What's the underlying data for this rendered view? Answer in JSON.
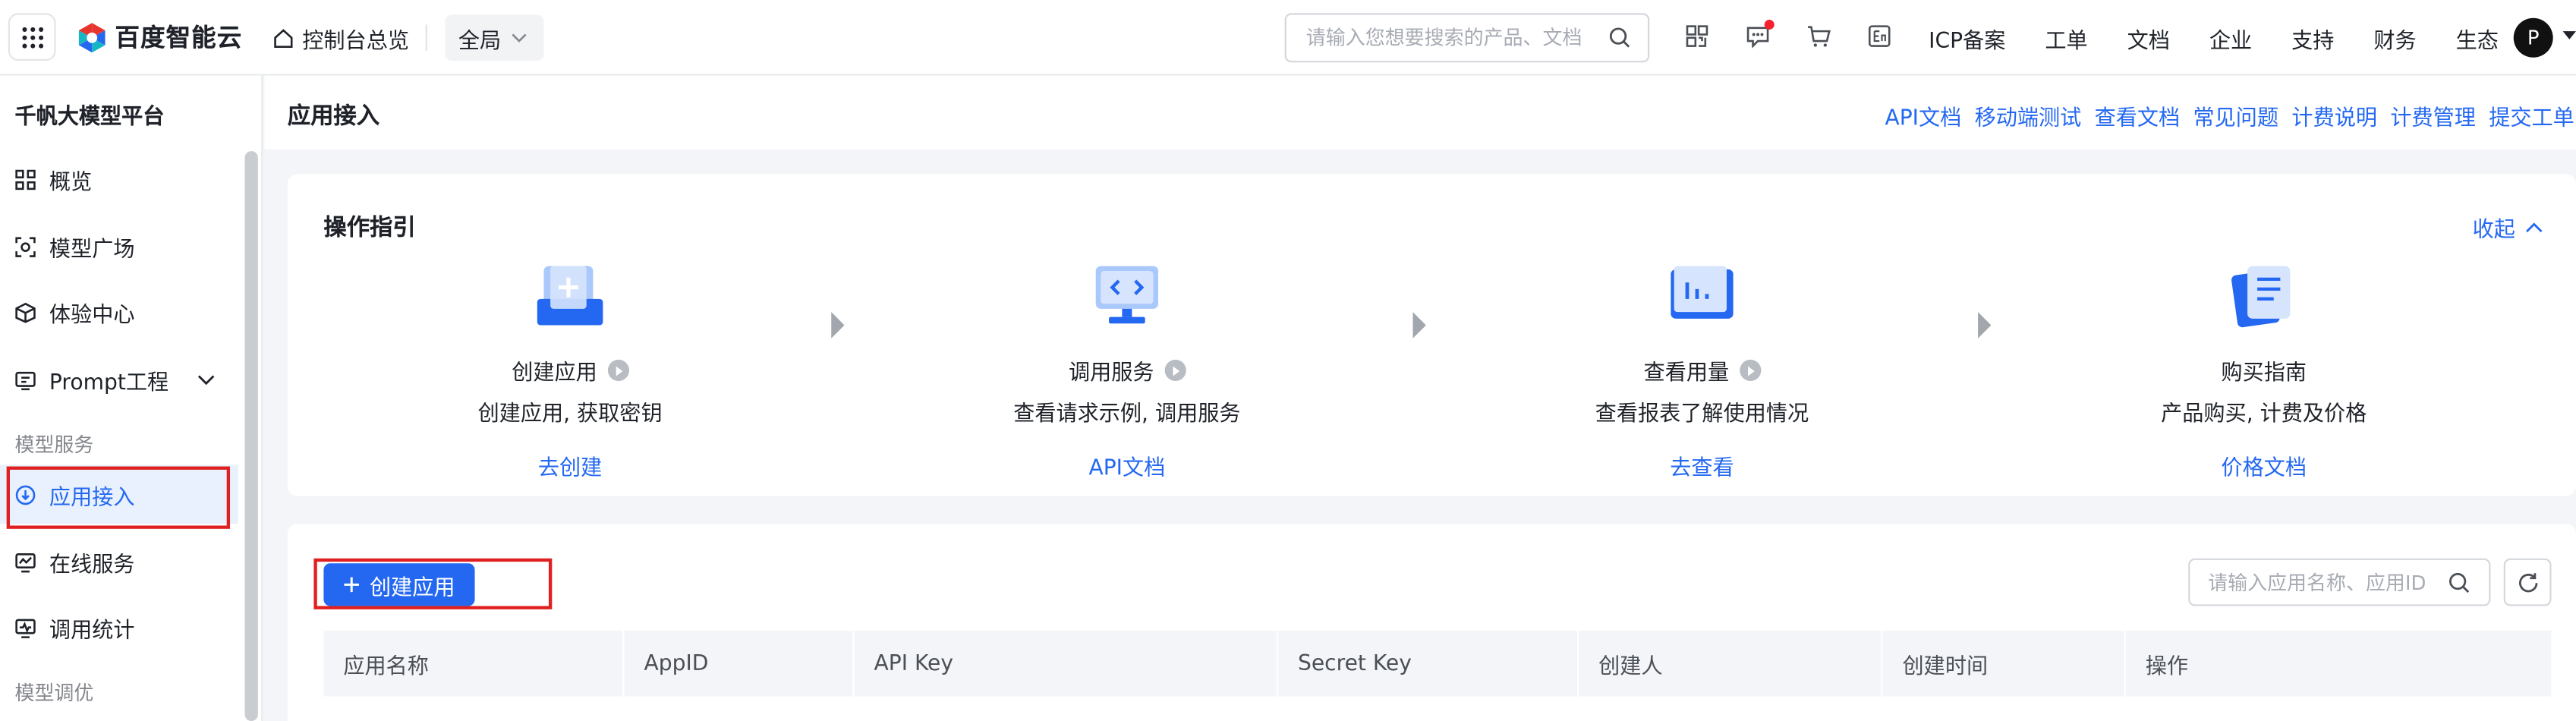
{
  "brand": {
    "name": "百度智能云",
    "colors": {
      "red": "#e8342e",
      "blue": "#2468f2",
      "teal": "#16b6c6"
    }
  },
  "topbar": {
    "console_label": "控制台总览",
    "region_label": "全局",
    "search_placeholder": "请输入您想要搜索的产品、文档",
    "icons": [
      "qr-code-icon",
      "message-icon",
      "cart-icon",
      "language-icon"
    ],
    "nav": [
      "ICP备案",
      "工单",
      "文档",
      "企业",
      "支持",
      "财务",
      "生态"
    ],
    "avatar_letter": "P"
  },
  "sidebar": {
    "title": "千帆大模型平台",
    "items": [
      {
        "label": "概览",
        "icon": "grid-icon"
      },
      {
        "label": "模型广场",
        "icon": "model-square-icon"
      },
      {
        "label": "体验中心",
        "icon": "cube-icon"
      },
      {
        "label": "Prompt工程",
        "icon": "prompt-icon"
      }
    ],
    "section_model_service": "模型服务",
    "service_items": [
      {
        "label": "应用接入",
        "icon": "app-access-icon",
        "active": true
      },
      {
        "label": "在线服务",
        "icon": "online-service-icon"
      },
      {
        "label": "调用统计",
        "icon": "stats-icon"
      }
    ],
    "section_model_tuning": "模型调优"
  },
  "page": {
    "title": "应用接入",
    "links": [
      "API文档",
      "移动端测试",
      "查看文档",
      "常见问题",
      "计费说明",
      "计费管理",
      "提交工单"
    ]
  },
  "guide": {
    "title": "操作指引",
    "collapse_label": "收起",
    "steps": [
      {
        "title": "创建应用",
        "desc": "创建应用, 获取密钥",
        "link": "去创建",
        "icon": "create-app-icon"
      },
      {
        "title": "调用服务",
        "desc": "查看请求示例, 调用服务",
        "link": "API文档",
        "icon": "call-service-icon"
      },
      {
        "title": "查看用量",
        "desc": "查看报表了解使用情况",
        "link": "去查看",
        "icon": "usage-icon"
      },
      {
        "title": "购买指南",
        "desc": "产品购买, 计费及价格",
        "link": "价格文档",
        "icon": "buy-guide-icon"
      }
    ]
  },
  "apps": {
    "create_label": "创建应用",
    "search_placeholder": "请输入应用名称、应用ID",
    "columns": [
      "应用名称",
      "AppID",
      "API Key",
      "Secret Key",
      "创建人",
      "创建时间",
      "操作"
    ]
  }
}
